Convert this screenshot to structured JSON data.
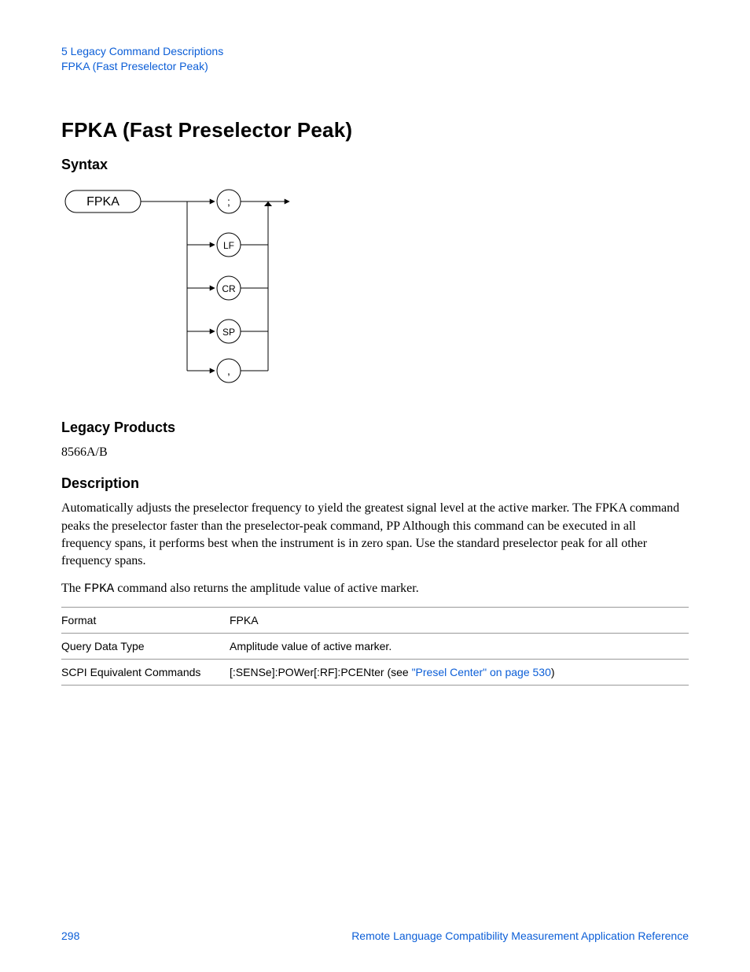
{
  "header": {
    "line1": "5  Legacy Command Descriptions",
    "line2": "FPKA (Fast Preselector Peak)"
  },
  "title": "FPKA (Fast Preselector Peak)",
  "sections": {
    "syntax": "Syntax",
    "legacy_products": "Legacy Products",
    "description": "Description"
  },
  "syntax_diagram": {
    "start": "FPKA",
    "terminators": [
      ";",
      "LF",
      "CR",
      "SP",
      ","
    ]
  },
  "legacy_products_text": "8566A/B",
  "description_p1": "Automatically adjusts the preselector frequency to yield the greatest signal level at the active marker. The FPKA command peaks the preselector faster than the preselector-peak command, PP Although this command can be executed in all frequency spans, it performs best when the instrument is in zero span. Use the standard preselector peak for all other frequency spans.",
  "description_p2_pre": "The ",
  "description_p2_code": "FPKA",
  "description_p2_post": " command also returns the amplitude value of active marker.",
  "table": {
    "rows": [
      {
        "label": "Format",
        "value": "FPKA"
      },
      {
        "label": "Query Data Type",
        "value": "Amplitude value of active marker."
      }
    ],
    "scpi": {
      "label": "SCPI Equivalent Commands",
      "prefix": "[:SENSe]:POWer[:RF]:PCENter (see ",
      "link": "\"Presel Center\" on page 530",
      "suffix": ")"
    }
  },
  "footer": {
    "page": "298",
    "ref": "Remote Language Compatibility Measurement Application Reference"
  }
}
